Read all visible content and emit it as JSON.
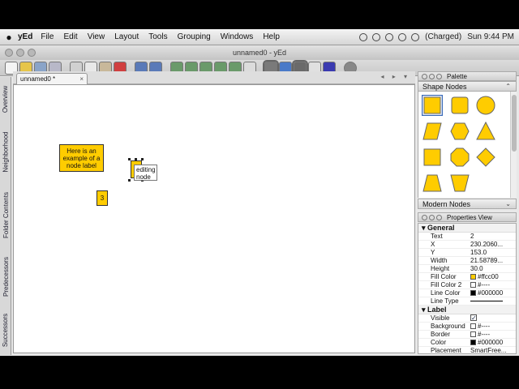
{
  "menubar": {
    "app": "yEd",
    "menus": [
      "File",
      "Edit",
      "View",
      "Layout",
      "Tools",
      "Grouping",
      "Windows",
      "Help"
    ],
    "battery": "(Charged)",
    "clock": "Sun 9:44 PM"
  },
  "window": {
    "title": "unnamed0 - yEd"
  },
  "left_tabs": [
    "Overview",
    "Neighborhood",
    "Folder Contents",
    "Predecessors",
    "Successors"
  ],
  "document_tab": {
    "label": "unnamed0 *",
    "close": "×",
    "nav": "◂ ▸ ▾"
  },
  "canvas": {
    "node_label_example": "Here is an example of a node label",
    "node_small_label": "3",
    "editing_text_line1": "editing",
    "editing_text_line2": "node"
  },
  "palette": {
    "header": "Palette",
    "section_shape": "Shape Nodes",
    "section_modern": "Modern Nodes",
    "shape_color": "#ffcc00"
  },
  "properties": {
    "header": "Properties View",
    "group_general": "General",
    "group_label": "Label",
    "general": [
      {
        "key": "Text",
        "value": "2"
      },
      {
        "key": "X",
        "value": "230.2060..."
      },
      {
        "key": "Y",
        "value": "153.0"
      },
      {
        "key": "Width",
        "value": "21.58789..."
      },
      {
        "key": "Height",
        "value": "30.0"
      },
      {
        "key": "Fill Color",
        "value": "#ffcc00"
      },
      {
        "key": "Fill Color 2",
        "value": "#----"
      },
      {
        "key": "Line Color",
        "value": "#000000"
      },
      {
        "key": "Line Type",
        "value": ""
      }
    ],
    "label": [
      {
        "key": "Visible",
        "value": "✓"
      },
      {
        "key": "Background",
        "value": "#----"
      },
      {
        "key": "Border",
        "value": "#----"
      },
      {
        "key": "Color",
        "value": "#000000"
      },
      {
        "key": "Placement",
        "value": "SmartFree..."
      }
    ]
  }
}
